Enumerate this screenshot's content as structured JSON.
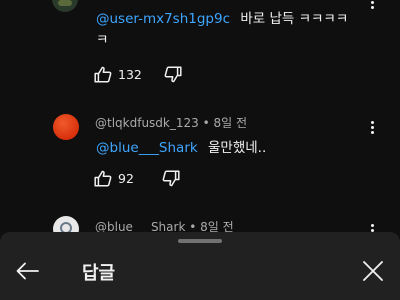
{
  "comments": [
    {
      "mention": "@user-mx7sh1gp9c",
      "text_line1": "바로 납득 ㅋㅋㅋㅋ",
      "text_line2": "ㅋ",
      "likes": "132"
    },
    {
      "author": "@tlqkdfusdk_123",
      "time": "8일 전",
      "mention": "@blue___Shark",
      "text": "울만했네..",
      "likes": "92",
      "avatar_color": "#e03a12"
    },
    {
      "author": "@blue___Shark",
      "time": "8일 전"
    }
  ],
  "sheet": {
    "title": "답글"
  },
  "colors": {
    "background": "#0f0f0f",
    "sheet": "#212121",
    "mention": "#3ea6ff",
    "meta": "#aaaaaa"
  }
}
